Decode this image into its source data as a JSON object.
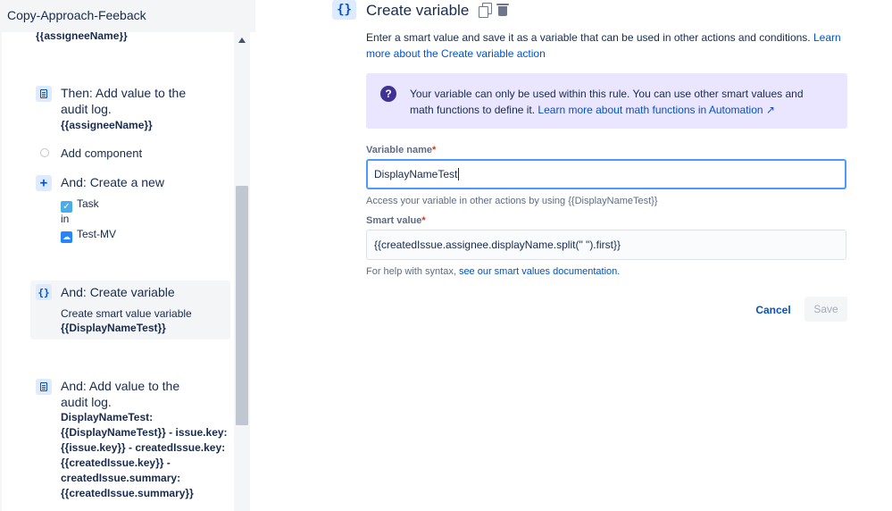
{
  "rule": {
    "title": "Copy-Approach-Feeback"
  },
  "components": {
    "top_partial": "{{assigneeName}}",
    "audit1": {
      "title_line1": "Then: Add value to the",
      "title_line2": "audit log.",
      "value": "{{assigneeName}}"
    },
    "add_component": "Add component",
    "create_issue": {
      "title": "And: Create a new",
      "issue_type": "Task",
      "in_label": "in",
      "project": "Test-MV"
    },
    "create_variable": {
      "title": "And: Create variable",
      "subtitle": "Create smart value variable",
      "value": "{{DisplayNameTest}}"
    },
    "audit2": {
      "title_line1": "And: Add value to the",
      "title_line2": "audit log.",
      "lines": [
        "DisplayNameTest:",
        "{{DisplayNameTest}} - issue.key:",
        "{{issue.key}} - createdIssue.key:",
        "{{createdIssue.key}} -",
        "createdIssue.summary:",
        "{{createdIssue.summary}}"
      ]
    }
  },
  "editor": {
    "icon_text": "{}",
    "title": "Create variable",
    "description": "Enter a smart value and save it as a variable that can be used in other actions and conditions. ",
    "description_link": "Learn more about the Create variable action",
    "info": {
      "text": "Your variable can only be used within this rule. You can use other smart values and math functions to define it. ",
      "link": "Learn more about math functions in Automation ↗"
    },
    "variable_name": {
      "label": "Variable name",
      "required_mark": "*",
      "value": "DisplayNameTest",
      "help": "Access your variable in other actions by using {{DisplayNameTest}}"
    },
    "smart_value": {
      "label": "Smart value",
      "required_mark": "*",
      "value": "{{createdIssue.assignee.displayName.split(\" \").first}}",
      "help_prefix": "For help with syntax, ",
      "help_link": "see our smart values documentation."
    },
    "cancel_label": "Cancel",
    "save_label": "Save"
  },
  "colors": {
    "accent": "#0052cc",
    "info_bg": "#eae6ff",
    "info_icon": "#403294",
    "focus_border": "#4c9aff",
    "required": "#de350b"
  },
  "icons": {
    "audit": "document-icon",
    "create_issue": "plus-icon",
    "variable": "curly-braces-icon",
    "copy": "copy-icon",
    "delete": "trash-icon",
    "info": "question-icon"
  }
}
